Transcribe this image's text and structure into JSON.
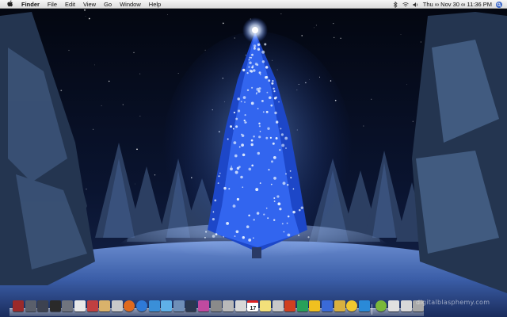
{
  "menubar": {
    "apple_icon": "apple-logo-icon",
    "app_name": "Finder",
    "items": [
      "File",
      "Edit",
      "View",
      "Go",
      "Window",
      "Help"
    ],
    "status_icons": [
      "bluetooth-icon",
      "wifi-icon",
      "volume-icon"
    ],
    "clock": "Thu ∞ Nov 30 ∞ 11:36 PM",
    "spotlight_icon": "spotlight-search-icon"
  },
  "dock": {
    "calendar_date": "17",
    "icons": [
      "finder-icon",
      "folder-icon",
      "preview-icon",
      "terminal-icon",
      "monitor-icon",
      "text-file-icon",
      "rocket-icon",
      "photo-icon",
      "address-book-icon",
      "firefox-icon",
      "safari-icon",
      "quicktime-icon",
      "itunes-icon",
      "mail-icon",
      "dashboard-icon",
      "photo-booth-icon",
      "system-preferences-icon",
      "disk-utility-icon",
      "script-icon",
      "ical-icon",
      "stickies-icon",
      "search-tool-icon",
      "graphic-icon",
      "code-editor-icon",
      "chat-icon",
      "pandora-icon",
      "dictionary-icon",
      "smiley-icon",
      "vpn-icon",
      "adium-icon",
      "network-icon",
      "window-icon",
      "trash-icon"
    ],
    "colors": [
      "#9b2a2a",
      "#5a5f6b",
      "#3d4250",
      "#2a2a2a",
      "#70747e",
      "#e8e8e8",
      "#c04040",
      "#d9b26b",
      "#c9c9c9",
      "#e06a1e",
      "#2f7ad8",
      "#3a8fd8",
      "#5fb0e8",
      "#6f8fb8",
      "#2a3850",
      "#c04aa0",
      "#8a8a8a",
      "#b9b9b9",
      "#d8d8d8",
      "#f4f4f4",
      "#f2e07a",
      "#c8c8c8",
      "#d04020",
      "#28a05a",
      "#f0c020",
      "#3a6ad8",
      "#d8b040",
      "#f0c830",
      "#2a8ad8",
      "#7ab83a",
      "#e0e0e0",
      "#d8d8d8",
      "#a8a8a8"
    ]
  },
  "watermark": "digitalblasphemy.com"
}
